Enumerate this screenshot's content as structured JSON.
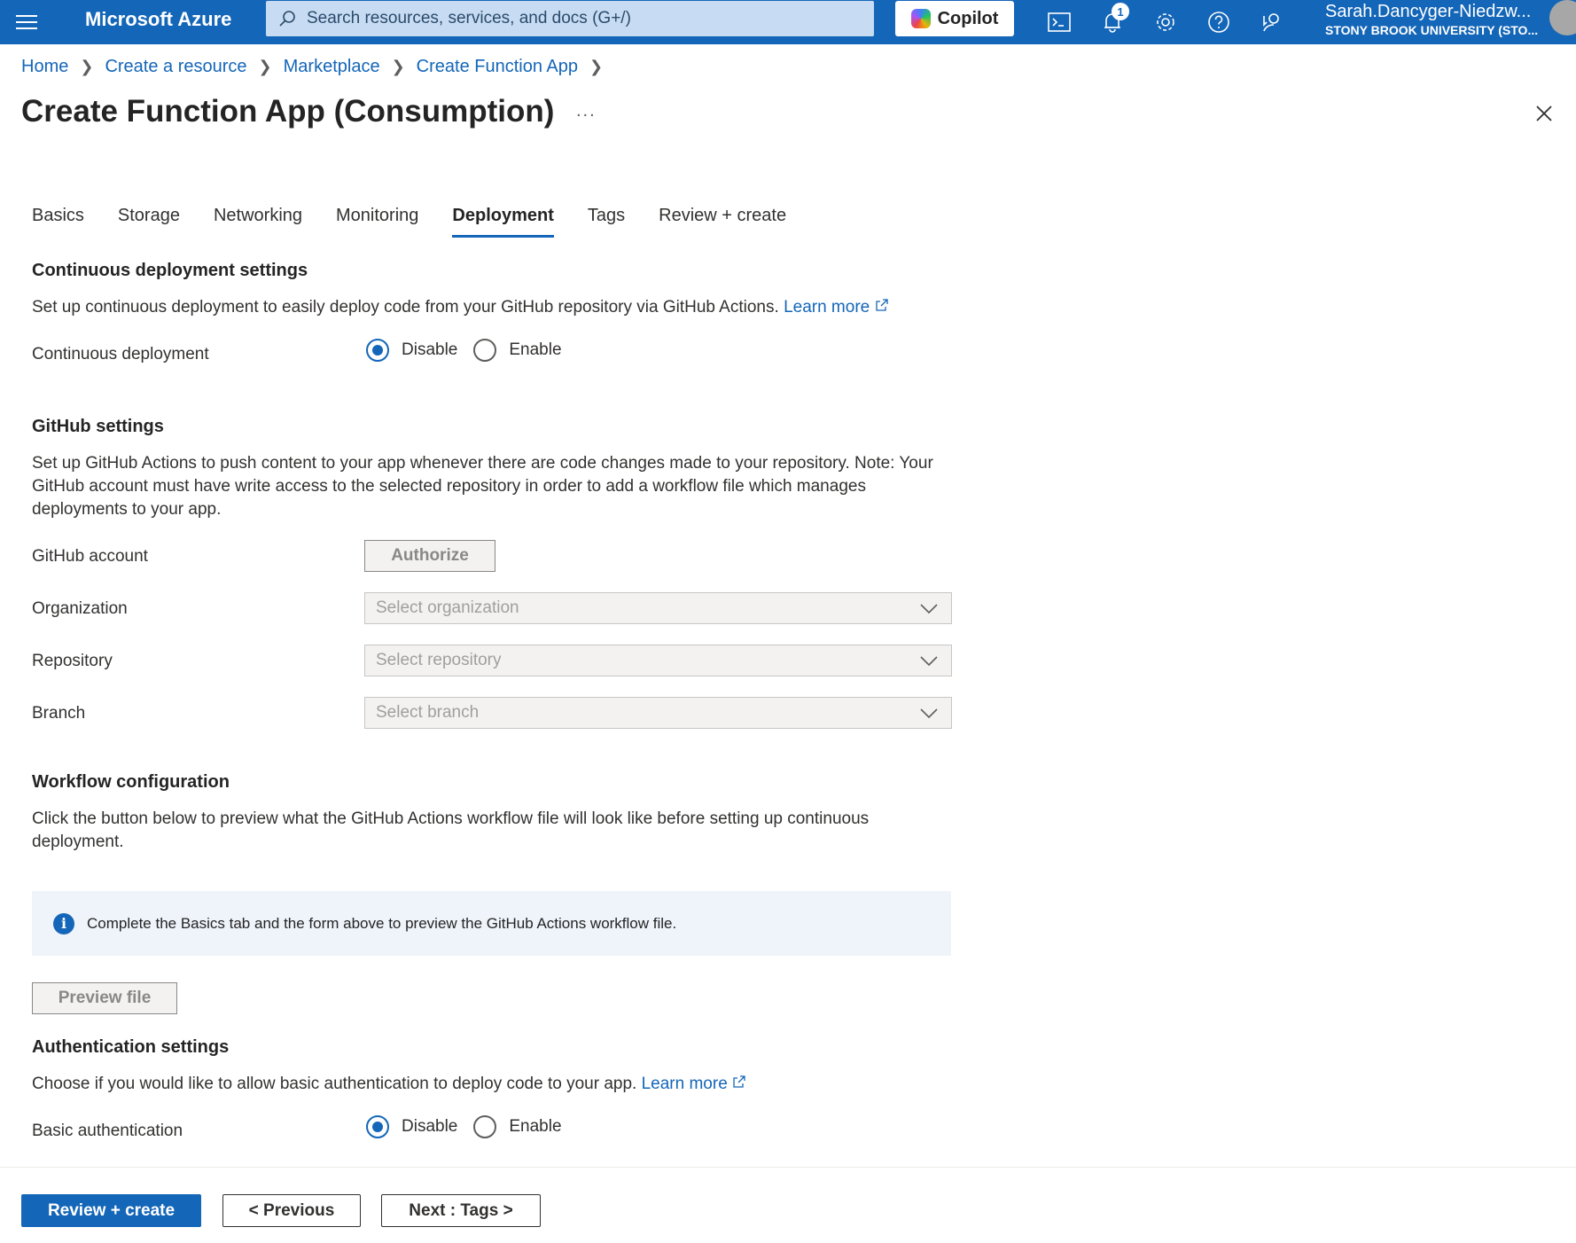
{
  "topbar": {
    "brand": "Microsoft Azure",
    "search_placeholder": "Search resources, services, and docs (G+/)",
    "copilot_label": "Copilot",
    "notification_count": "1",
    "user_name": "Sarah.Dancyger-Niedzw...",
    "user_org": "STONY BROOK UNIVERSITY (STO..."
  },
  "breadcrumb": [
    "Home",
    "Create a resource",
    "Marketplace",
    "Create Function App"
  ],
  "page": {
    "title": "Create Function App (Consumption)",
    "more_label": "..."
  },
  "tabs": [
    "Basics",
    "Storage",
    "Networking",
    "Monitoring",
    "Deployment",
    "Tags",
    "Review + create"
  ],
  "active_tab": "Deployment",
  "continuous": {
    "title": "Continuous deployment settings",
    "description": "Set up continuous deployment to easily deploy code from your GitHub repository via GitHub Actions.",
    "learn_more": "Learn more",
    "field_label": "Continuous deployment",
    "option_disable": "Disable",
    "option_enable": "Enable",
    "selected": "Disable"
  },
  "github": {
    "title": "GitHub settings",
    "description": "Set up GitHub Actions to push content to your app whenever there are code changes made to your repository. Note: Your GitHub account must have write access to the selected repository in order to add a workflow file which manages deployments to your app.",
    "account_label": "GitHub account",
    "authorize_label": "Authorize",
    "organization_label": "Organization",
    "organization_placeholder": "Select organization",
    "repository_label": "Repository",
    "repository_placeholder": "Select repository",
    "branch_label": "Branch",
    "branch_placeholder": "Select branch"
  },
  "workflow": {
    "title": "Workflow configuration",
    "description": "Click the button below to preview what the GitHub Actions workflow file will look like before setting up continuous deployment.",
    "info_text": "Complete the Basics tab and the form above to preview the GitHub Actions workflow file.",
    "preview_label": "Preview file"
  },
  "auth": {
    "title": "Authentication settings",
    "description": "Choose if you would like to allow basic authentication to deploy code to your app.",
    "learn_more": "Learn more",
    "field_label": "Basic authentication",
    "option_disable": "Disable",
    "option_enable": "Enable",
    "selected": "Disable"
  },
  "footer": {
    "review_label": "Review + create",
    "previous_label": "< Previous",
    "next_label": "Next : Tags >"
  },
  "colors": {
    "accent": "#1466b8",
    "info_bg": "#eff4fa"
  }
}
